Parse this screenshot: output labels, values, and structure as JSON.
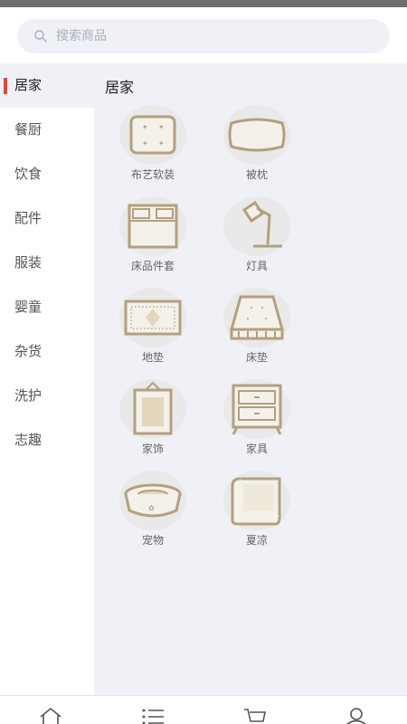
{
  "search": {
    "placeholder": "搜索商品"
  },
  "sidebar": {
    "items": [
      {
        "label": "居家"
      },
      {
        "label": "餐厨"
      },
      {
        "label": "饮食"
      },
      {
        "label": "配件"
      },
      {
        "label": "服装"
      },
      {
        "label": "婴童"
      },
      {
        "label": "杂货"
      },
      {
        "label": "洗护"
      },
      {
        "label": "志趣"
      }
    ],
    "active": "居家"
  },
  "content": {
    "title": "居家",
    "categories": [
      {
        "label": "布艺软装",
        "icon": "cushion-icon"
      },
      {
        "label": "被枕",
        "icon": "pillow-icon"
      },
      {
        "label": "床品件套",
        "icon": "bedding-icon"
      },
      {
        "label": "灯具",
        "icon": "lamp-icon"
      },
      {
        "label": "地垫",
        "icon": "rug-icon"
      },
      {
        "label": "床垫",
        "icon": "mattress-icon"
      },
      {
        "label": "家饰",
        "icon": "frame-icon"
      },
      {
        "label": "家具",
        "icon": "cabinet-icon"
      },
      {
        "label": "宠物",
        "icon": "pet-bed-icon"
      },
      {
        "label": "夏凉",
        "icon": "summer-mat-icon"
      }
    ]
  },
  "colors": {
    "accent": "#e2473b",
    "icon_stroke": "#b3a07e",
    "panel_bg": "#eff1f6"
  },
  "bottom_nav": [
    "home-icon",
    "category-icon",
    "cart-icon",
    "profile-icon"
  ]
}
